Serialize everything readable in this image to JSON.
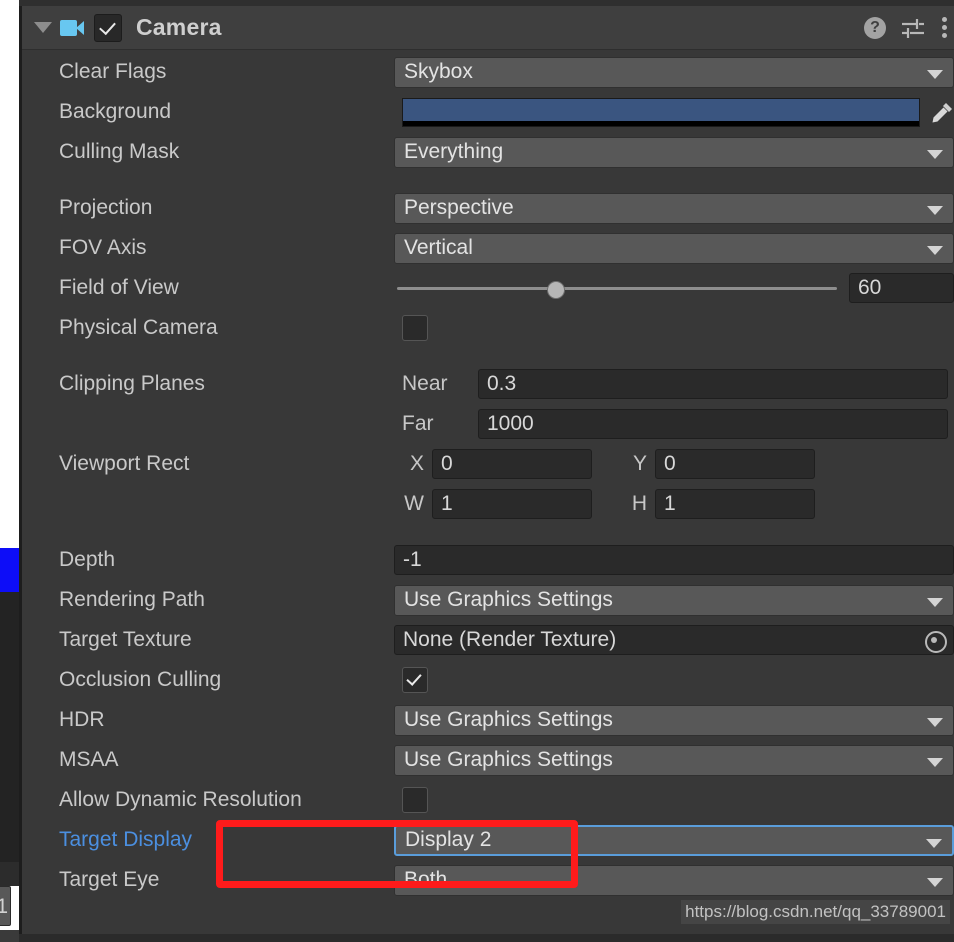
{
  "component": {
    "title": "Camera",
    "enabled": true,
    "expanded": true,
    "icons": {
      "foldout": "triangle-down-icon",
      "component": "camera-icon",
      "help": "?",
      "preset": "preset-sliders-icon",
      "menu": "kebab-menu-icon"
    }
  },
  "properties": {
    "clear_flags": {
      "label": "Clear Flags",
      "value": "Skybox"
    },
    "background": {
      "label": "Background",
      "color": "#3a5580",
      "alpha_color": "#000000"
    },
    "culling_mask": {
      "label": "Culling Mask",
      "value": "Everything"
    },
    "projection": {
      "label": "Projection",
      "value": "Perspective"
    },
    "fov_axis": {
      "label": "FOV Axis",
      "value": "Vertical"
    },
    "field_of_view": {
      "label": "Field of View",
      "value": "60",
      "slider_percent": 35
    },
    "physical_camera": {
      "label": "Physical Camera",
      "checked": false
    },
    "clipping_planes": {
      "label": "Clipping Planes",
      "near_label": "Near",
      "near_value": "0.3",
      "far_label": "Far",
      "far_value": "1000"
    },
    "viewport_rect": {
      "label": "Viewport Rect",
      "x_label": "X",
      "x_value": "0",
      "y_label": "Y",
      "y_value": "0",
      "w_label": "W",
      "w_value": "1",
      "h_label": "H",
      "h_value": "1"
    },
    "depth": {
      "label": "Depth",
      "value": "-1"
    },
    "rendering_path": {
      "label": "Rendering Path",
      "value": "Use Graphics Settings"
    },
    "target_texture": {
      "label": "Target Texture",
      "value": "None (Render Texture)"
    },
    "occlusion_culling": {
      "label": "Occlusion Culling",
      "checked": true
    },
    "hdr": {
      "label": "HDR",
      "value": "Use Graphics Settings"
    },
    "msaa": {
      "label": "MSAA",
      "value": "Use Graphics Settings"
    },
    "allow_dynamic_resolution": {
      "label": "Allow Dynamic Resolution",
      "checked": false
    },
    "target_display": {
      "label": "Target Display",
      "value": "Display 2",
      "highlighted": true,
      "focused": true
    },
    "target_eye": {
      "label": "Target Eye",
      "value": "Both"
    }
  },
  "annotation": {
    "color": "#fe1b1b",
    "shape": "rectangle"
  },
  "watermark": {
    "text": "https://blog.csdn.net/qq_33789001"
  },
  "left_edge": {
    "partial_field_value": "1",
    "marker_color": "#0d0df8"
  }
}
